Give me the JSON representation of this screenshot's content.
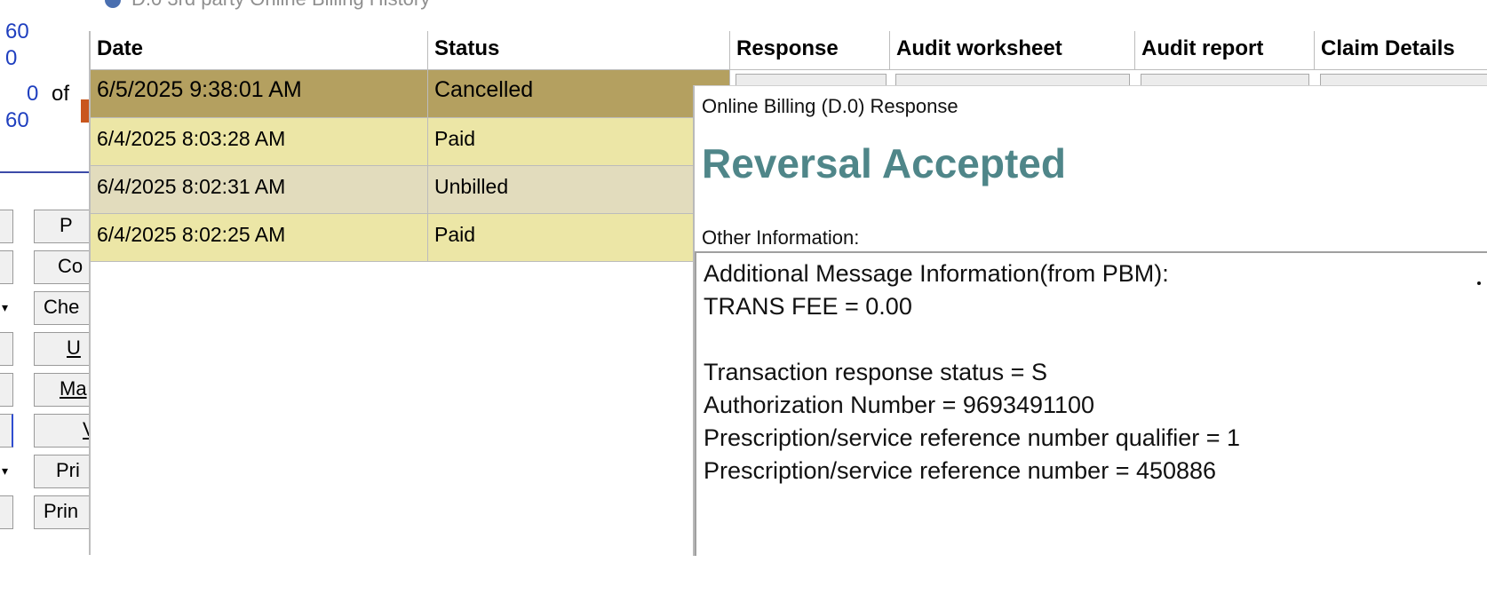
{
  "window": {
    "title": "D.0 3rd party Online Billing History"
  },
  "left_panel": {
    "numbers": [
      "60",
      "0",
      "0",
      "of",
      "60"
    ],
    "buttons": [
      "P",
      "Co",
      "Che",
      "U",
      "Ma",
      "V",
      "Pri",
      "Prin"
    ]
  },
  "grid": {
    "columns": [
      "Date",
      "Status",
      "Response",
      "Audit worksheet",
      "Audit report",
      "Claim Details"
    ],
    "rows": [
      {
        "date": "6/5/2025 9:38:01 AM",
        "status": "Cancelled",
        "color": "#b4a060"
      },
      {
        "date": "6/4/2025 8:03:28 AM",
        "status": "Paid",
        "color": "#ece6a6"
      },
      {
        "date": "6/4/2025 8:02:31 AM",
        "status": "Unbilled",
        "color": "#e2dcbd"
      },
      {
        "date": "6/4/2025 8:02:25 AM",
        "status": "Paid",
        "color": "#ece6a6"
      }
    ]
  },
  "popup": {
    "title": "Online Billing (D.0) Response",
    "heading": "Reversal Accepted",
    "heading_color": "#4f8689",
    "other_label": "Other Information:",
    "message_lines": [
      "Additional Message Information(from PBM):",
      "TRANS FEE = 0.00",
      "",
      "Transaction response status = S",
      "Authorization Number = 9693491100",
      "Prescription/service reference number qualifier = 1",
      "Prescription/service reference number = 450886"
    ]
  }
}
